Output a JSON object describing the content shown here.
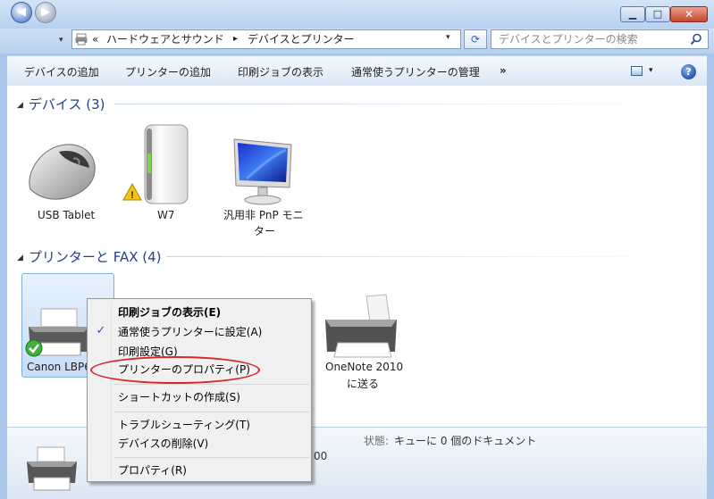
{
  "window": {
    "minimize": "▁",
    "maximize": "□",
    "close": "✕"
  },
  "nav": {
    "back": "◀",
    "forward": "▶",
    "dropdown": "▾"
  },
  "address": {
    "overflow": "«",
    "crumb1": "ハードウェアとサウンド",
    "sep": "▸",
    "crumb2": "デバイスとプリンター",
    "dropdown": "▾",
    "refresh": "⟳"
  },
  "search": {
    "placeholder": "デバイスとプリンターの検索"
  },
  "toolbar": {
    "add_device": "デバイスの追加",
    "add_printer": "プリンターの追加",
    "print_jobs": "印刷ジョブの表示",
    "manage_default": "通常使うプリンターの管理",
    "more": "»",
    "view_dropdown": "▾",
    "help": "?"
  },
  "groups": {
    "devices": {
      "arrow": "◢",
      "title": "デバイス (3)"
    },
    "printers": {
      "arrow": "◢",
      "title": "プリンターと FAX (4)"
    }
  },
  "devices": [
    {
      "label": "USB Tablet",
      "icon": "mouse-icon"
    },
    {
      "label": "W7",
      "icon": "computer-tower-icon"
    },
    {
      "label": "汎用非 PnP モニ",
      "label2": "ター",
      "icon": "monitor-icon"
    }
  ],
  "printers": [
    {
      "label": "Canon LBP6",
      "icon": "printer-icon",
      "default": true
    },
    {
      "label": "OneNote 2010",
      "label2": "に送る",
      "icon": "printer-icon"
    }
  ],
  "details": {
    "status_label": "状態:",
    "status_value": "キューに 0 個のドキュメント",
    "extra": "00"
  },
  "context_menu": {
    "items": [
      {
        "label": "印刷ジョブの表示(E)",
        "bold": true
      },
      {
        "label": "通常使うプリンターに設定(A)",
        "checked": true
      },
      {
        "label": "印刷設定(G)"
      },
      {
        "label": "プリンターのプロパティ(P)",
        "highlighted": true
      },
      {
        "label": "ショートカットの作成(S)"
      },
      {
        "label": "トラブルシューティング(T)"
      },
      {
        "label": "デバイスの削除(V)"
      },
      {
        "label": "プロパティ(R)"
      }
    ],
    "check": "✓"
  },
  "colors": {
    "title_blue": "#1f3f8f",
    "highlight_red": "#d9262b"
  }
}
